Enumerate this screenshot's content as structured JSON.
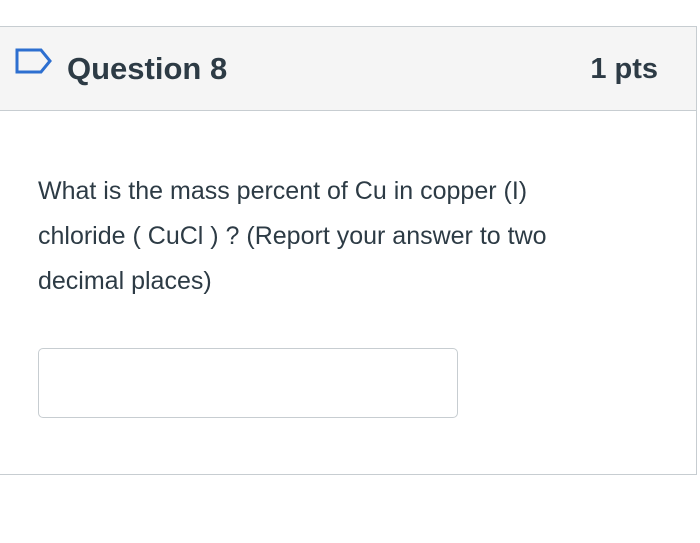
{
  "question": {
    "flag_icon": "flag-outline-icon",
    "title": "Question 8",
    "points": "1 pts",
    "text_line_1": "What is the mass percent of Cu in copper (I)",
    "text_line_2": "chloride ( CuCl ) ? (Report your answer to two",
    "text_line_3": "decimal places)",
    "answer_value": "",
    "answer_placeholder": ""
  },
  "colors": {
    "header_background": "#f5f5f5",
    "border": "#c7cdd1",
    "text": "#2d3b45",
    "flag_stroke": "#2d6fd0"
  }
}
